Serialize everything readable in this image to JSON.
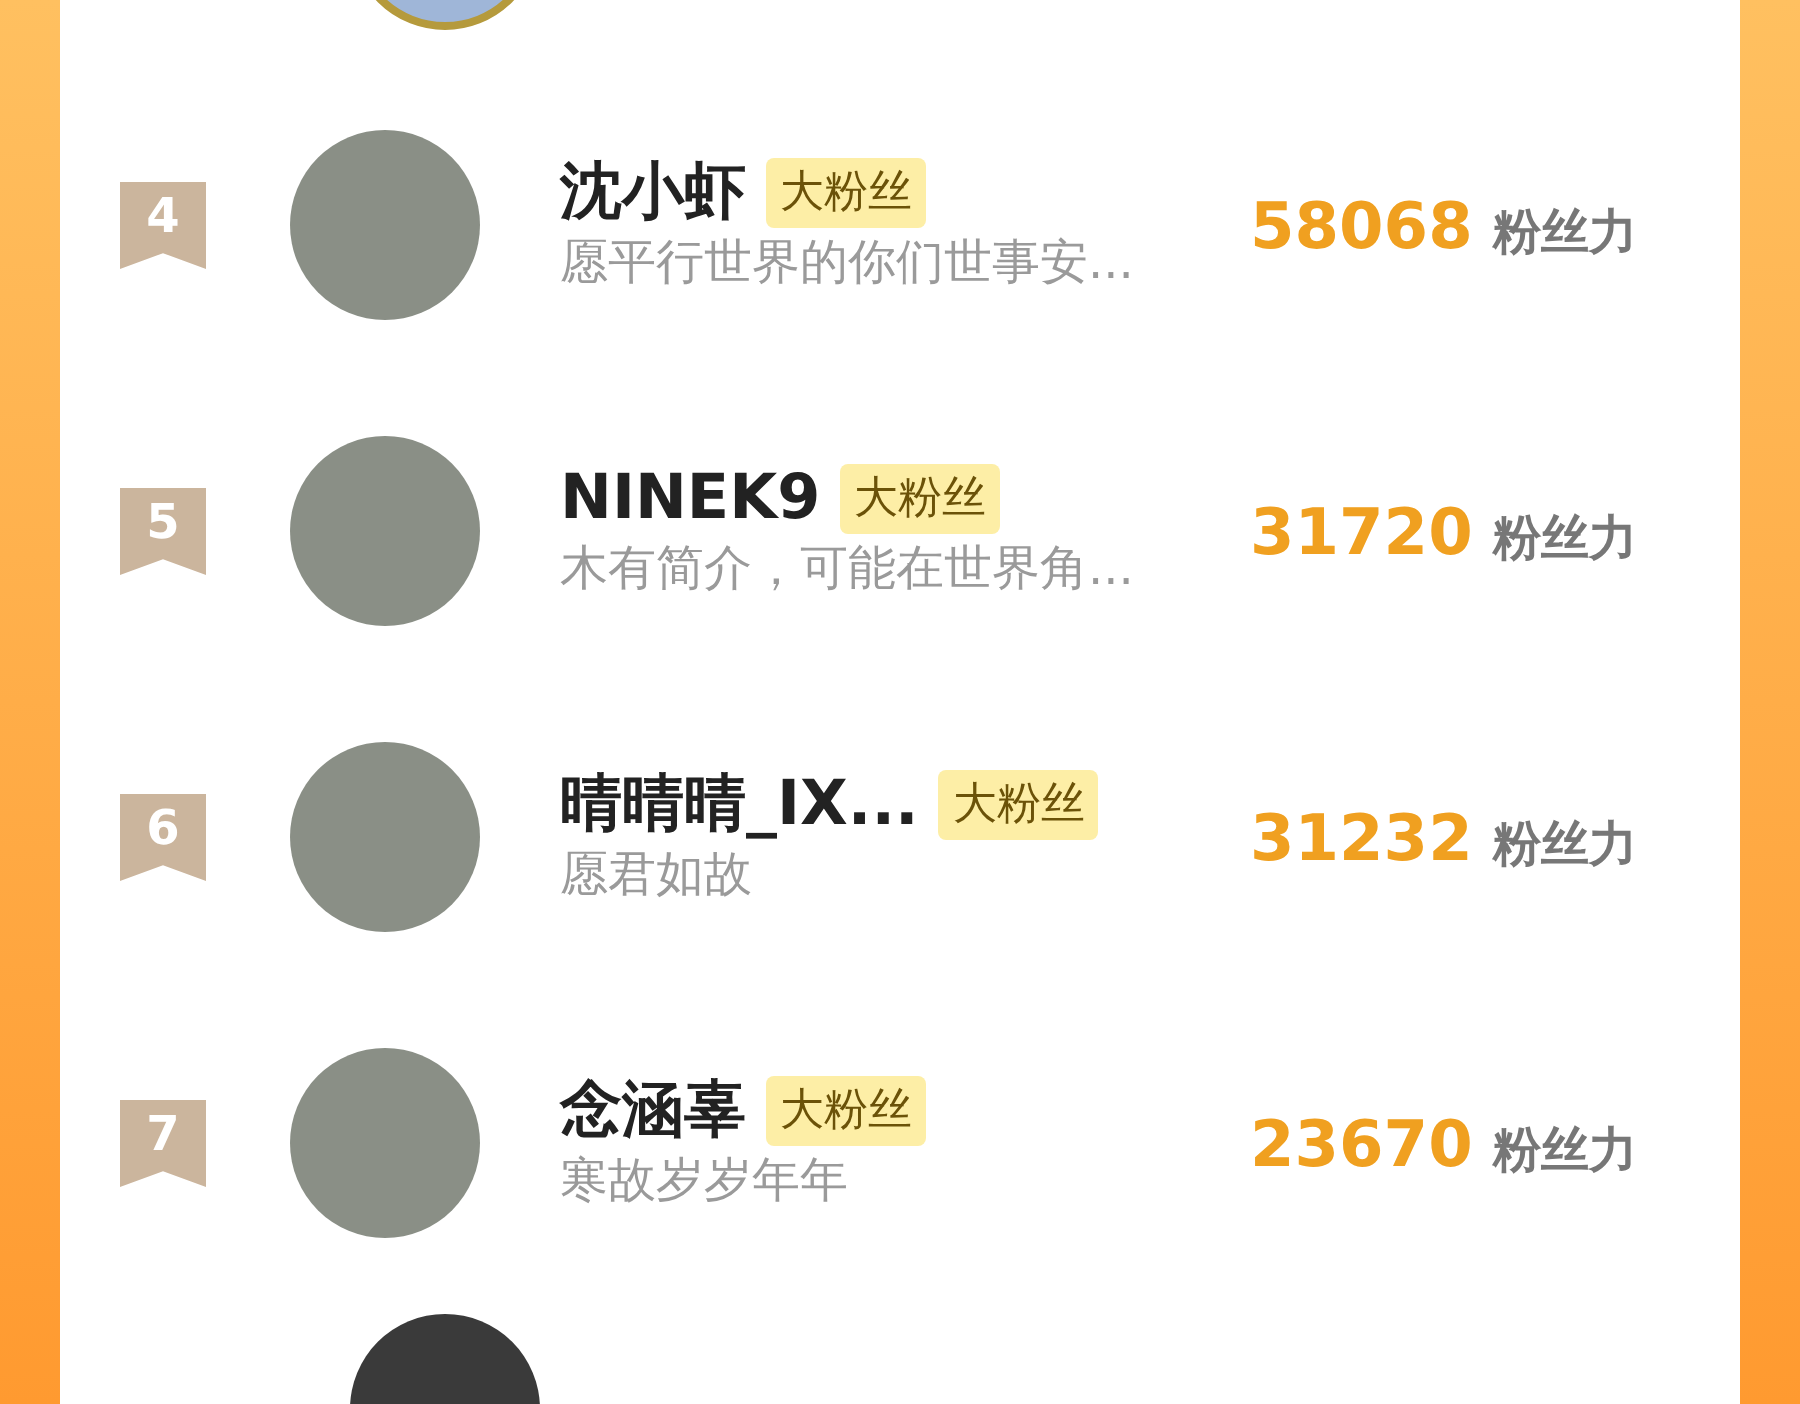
{
  "fans": [
    {
      "rank": "4",
      "name": "沈小虾",
      "badge": "大粉丝",
      "bio": "愿平行世界的你们世事安...",
      "score": "58068",
      "unit": "粉丝力"
    },
    {
      "rank": "5",
      "name": "NINEK9",
      "badge": "大粉丝",
      "bio": "木有简介，可能在世界角...",
      "score": "31720",
      "unit": "粉丝力"
    },
    {
      "rank": "6",
      "name": "晴晴晴_IX...",
      "badge": "大粉丝",
      "bio": "愿君如故",
      "score": "31232",
      "unit": "粉丝力"
    },
    {
      "rank": "7",
      "name": "念涵辜",
      "badge": "大粉丝",
      "bio": "寒故岁岁年年",
      "score": "23670",
      "unit": "粉丝力"
    }
  ]
}
